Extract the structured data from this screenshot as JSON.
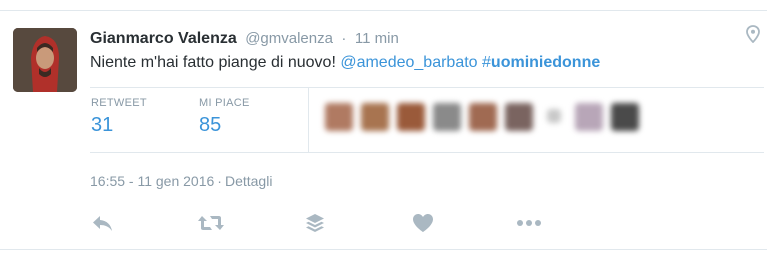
{
  "tweet": {
    "fullname": "Gianmarco Valenza",
    "username": "@gmvalenza",
    "separator": "·",
    "time": "11 min",
    "text_plain": "Niente m'hai fatto piange di nuovo! ",
    "mention": "@amedeo_barbato",
    "hashtag_hash": "#",
    "hashtag_word": "uominiedonne",
    "stats": {
      "retweet_label": "RETWEET",
      "retweet_count": "31",
      "likes_label": "MI PIACE",
      "likes_count": "85"
    },
    "timestamp": {
      "datetime": "16:55 - 11 gen 2016",
      "separator": "·",
      "details": "Dettagli"
    }
  },
  "icons": {
    "location": "map-pin-icon",
    "reply": "reply-icon",
    "retweet": "retweet-icon",
    "buffer": "buffer-layers-icon",
    "like": "heart-icon",
    "more": "more-dots-icon"
  },
  "colors": {
    "link": "#3b94d9",
    "muted": "#8899a6",
    "text": "#292f33",
    "border": "#e1e8ed",
    "action_icon": "#aab8c2"
  }
}
